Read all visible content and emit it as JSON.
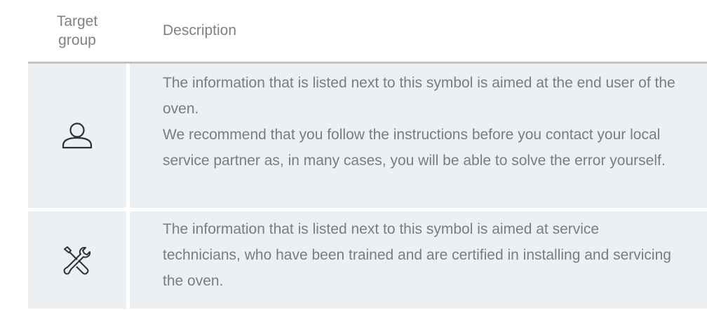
{
  "header": {
    "target_group_label": "Target\ngroup",
    "target_group_line1": "Target",
    "target_group_line2": "group",
    "description_label": "Description"
  },
  "rows": [
    {
      "icon": "user-icon",
      "paragraphs": [
        "The information that is listed next to this symbol is aimed at the end user of the oven.",
        "We recommend that you follow the instructions before you contact your local service partner as, in many cases, you will be able to solve the error yourself."
      ]
    },
    {
      "icon": "tools-icon",
      "paragraphs": [
        "The information that is listed next to this symbol is aimed at service technicians, who have been trained and are certified in installing and servicing the oven."
      ]
    }
  ],
  "colors": {
    "row_background": "#edf0f3",
    "header_rule": "#bfc2c7",
    "text": "#7a7c80",
    "icon_stroke": "#2e3033"
  }
}
